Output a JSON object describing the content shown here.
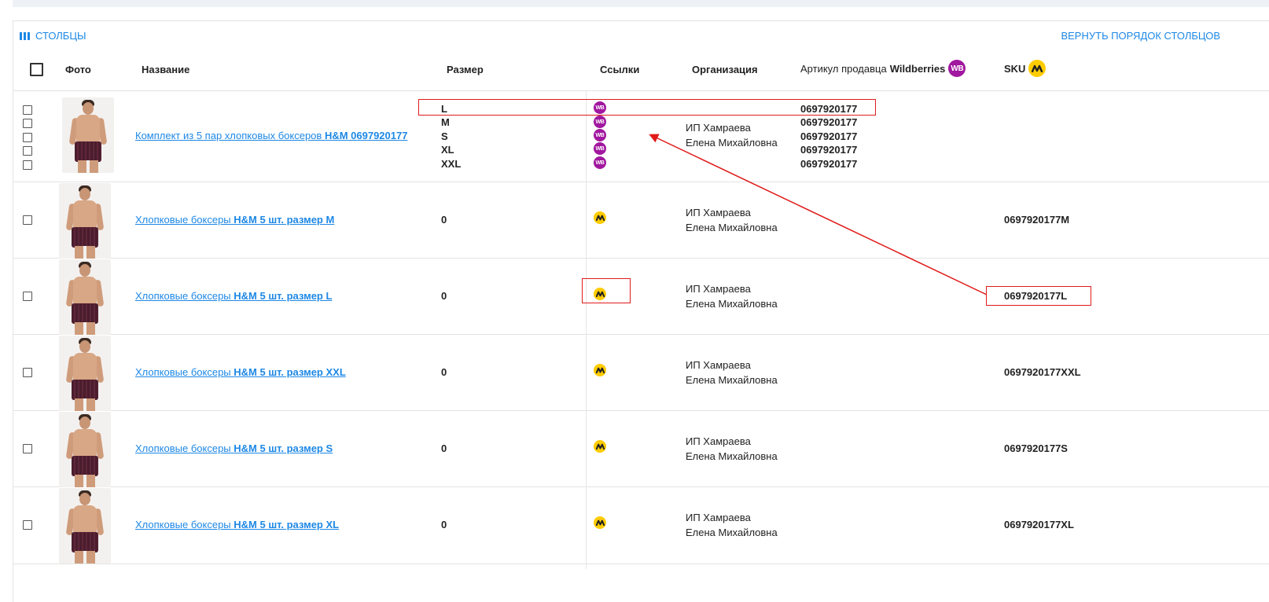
{
  "toolbar": {
    "columns_label": "СТОЛБЦЫ",
    "reset_order_label": "ВЕРНУТЬ ПОРЯДОК СТОЛБЦОВ"
  },
  "header": {
    "photo": "Фото",
    "name": "Название",
    "size": "Размер",
    "links": "Ссылки",
    "organization": "Организация",
    "wb_article_prefix": "Артикул продавца",
    "wb_article_brand": "Wildberries",
    "sku": "SKU"
  },
  "icons": {
    "wb_badge": "WB",
    "wb_color": "#a1179f",
    "yandex_market_color": "#ffcc00"
  },
  "rows": [
    {
      "name_prefix": "Комплект из 5 пар хлопковых боксеров ",
      "name_bold": "H&M 0697920177",
      "sizes": [
        "L",
        "M",
        "S",
        "XL",
        "XXL"
      ],
      "org_line1": "ИП Хамраева",
      "org_line2": "Елена Михайловна",
      "wb_articles": [
        "0697920177",
        "0697920177",
        "0697920177",
        "0697920177",
        "0697920177"
      ],
      "sku": ""
    },
    {
      "name_prefix": "Хлопковые боксеры ",
      "name_bold": "H&M 5 шт. размер M",
      "size": "0",
      "org_line1": "ИП Хамраева",
      "org_line2": "Елена Михайловна",
      "sku": "0697920177M"
    },
    {
      "name_prefix": "Хлопковые боксеры ",
      "name_bold": "H&M 5 шт. размер L",
      "size": "0",
      "org_line1": "ИП Хамраева",
      "org_line2": "Елена Михайловна",
      "sku": "0697920177L"
    },
    {
      "name_prefix": "Хлопковые боксеры ",
      "name_bold": "H&M 5 шт. размер XXL",
      "size": "0",
      "org_line1": "ИП Хамраева",
      "org_line2": "Елена Михайловна",
      "sku": "0697920177XXL"
    },
    {
      "name_prefix": "Хлопковые боксеры ",
      "name_bold": "H&M 5 шт. размер S",
      "size": "0",
      "org_line1": "ИП Хамраева",
      "org_line2": "Елена Михайловна",
      "sku": "0697920177S"
    },
    {
      "name_prefix": "Хлопковые боксеры ",
      "name_bold": "H&M 5 шт. размер XL",
      "size": "0",
      "org_line1": "ИП Хамраева",
      "org_line2": "Елена Михайловна",
      "sku": "0697920177XL"
    }
  ]
}
